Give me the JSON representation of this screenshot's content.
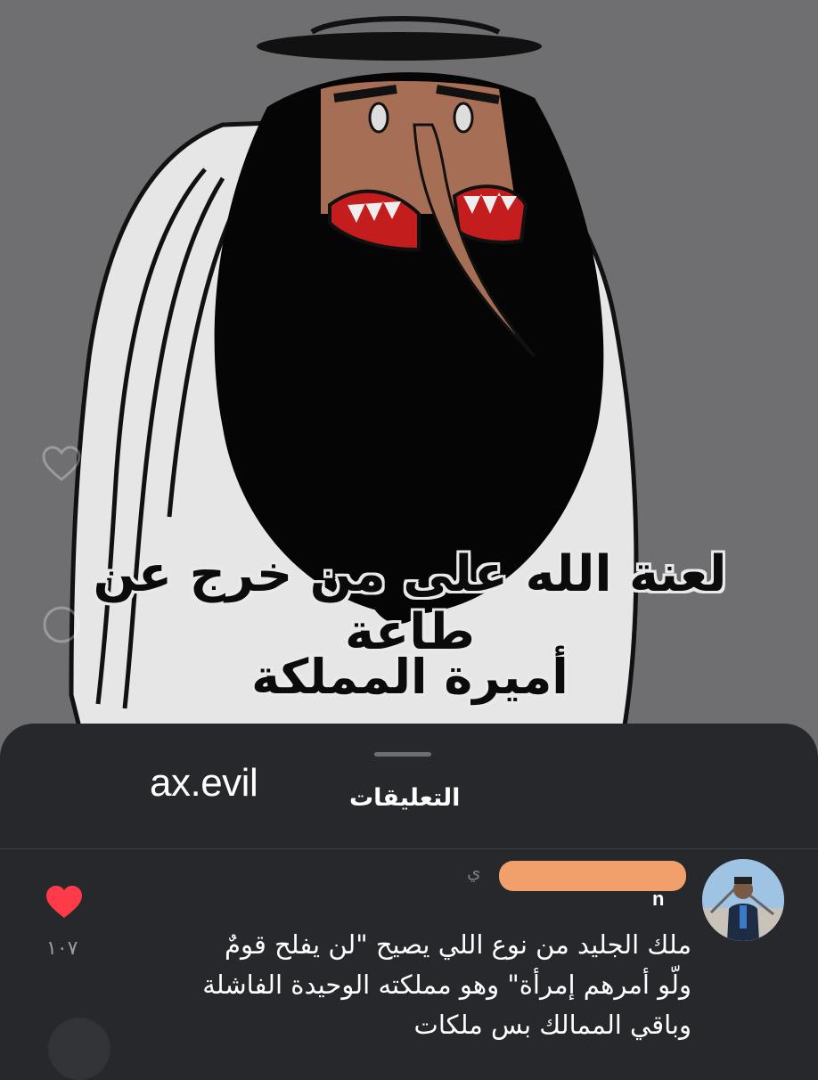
{
  "meme": {
    "caption_line1": "لعنة الله على من خرج عن طاعة",
    "caption_line2": "أميرة المملكة"
  },
  "comments_sheet": {
    "watermark": "ax.evil",
    "title": "التعليقات",
    "comment": {
      "username_faint": "ي",
      "username_suffix": "n",
      "text": "ملك الجليد من نوع اللي يصيح \"لن يفلح قومٌ\nولّو أمرهم إمرأة\" وهو مملكته الوحيدة الفاشلة\nوباقي الممالك بس ملكات",
      "like_count": "١٠٧",
      "like_color": "#ff3b4a"
    }
  },
  "colors": {
    "sheet_background": "#26282b",
    "image_background": "#6f6f72"
  }
}
